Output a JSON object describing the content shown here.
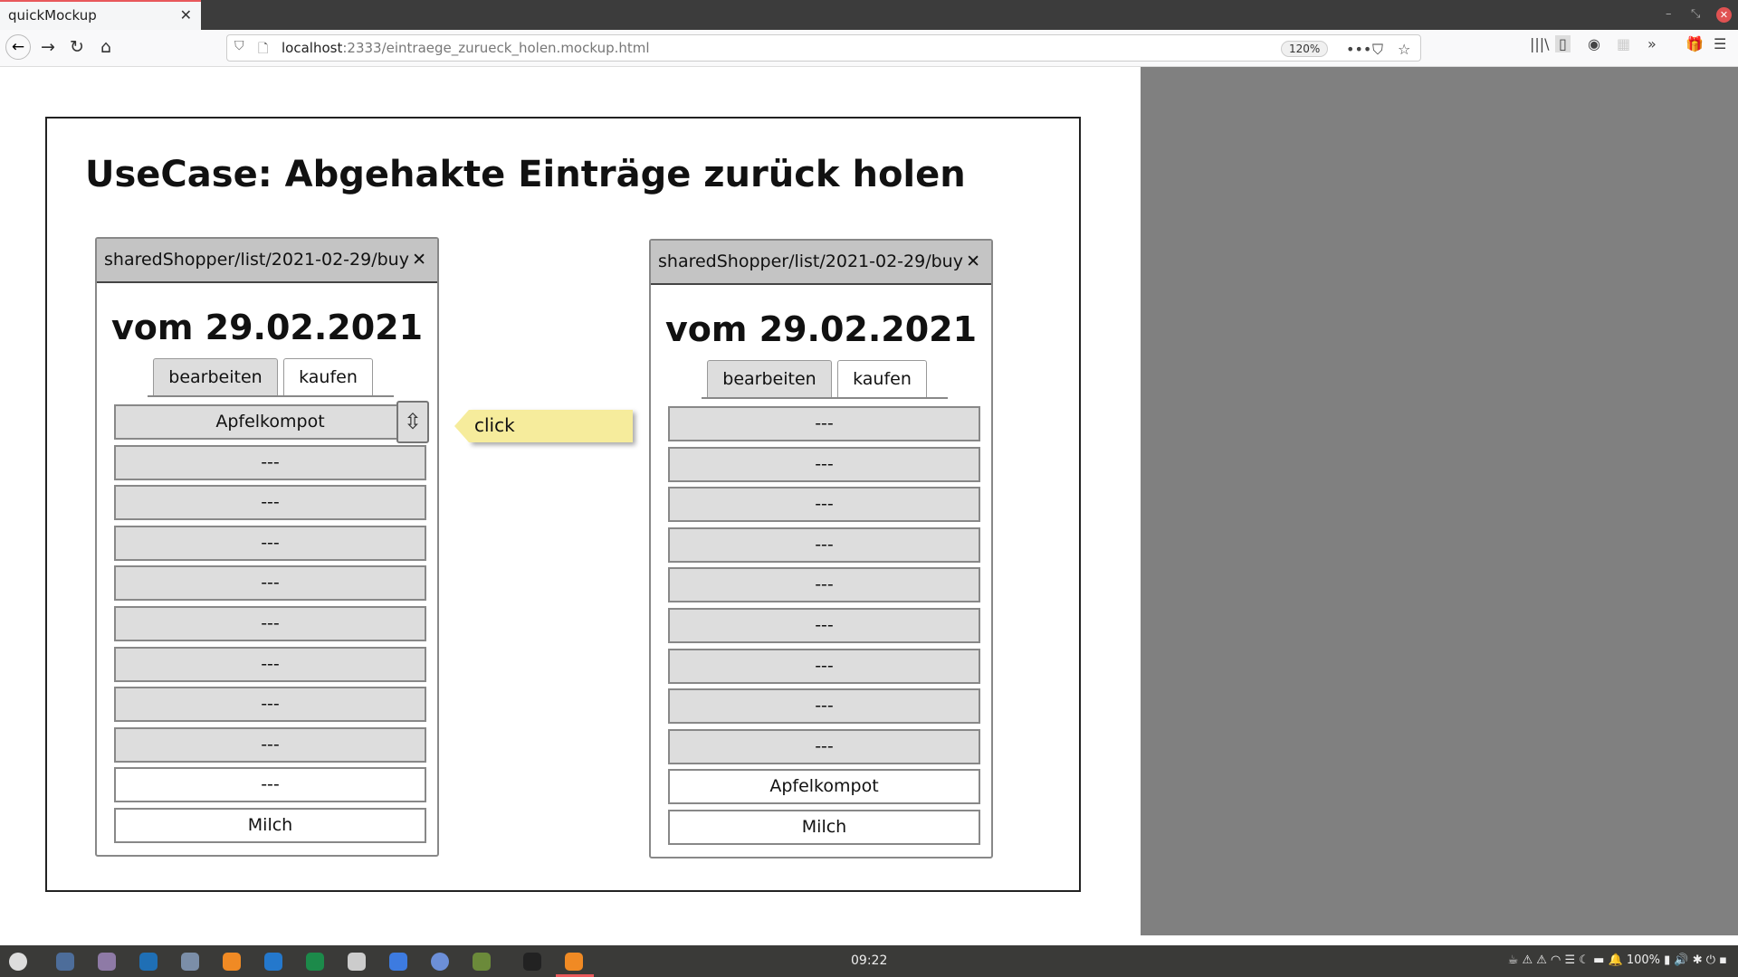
{
  "browser": {
    "tab_title": "quickMockup",
    "url_host": "localhost",
    "url_path": ":2333/eintraege_zurueck_holen.mockup.html",
    "zoom": "120%"
  },
  "mockup": {
    "title": "UseCase: Abgehakte Einträge zurück holen",
    "left": {
      "header": "sharedShopper/list/2021-02-29/buy",
      "date": "vom 29.02.2021",
      "tabs": [
        "bearbeiten",
        "kaufen"
      ],
      "rows": [
        {
          "text": "Apfelkompot",
          "checked": false
        },
        {
          "text": "---",
          "checked": false
        },
        {
          "text": "---",
          "checked": false
        },
        {
          "text": "---",
          "checked": false
        },
        {
          "text": "---",
          "checked": false
        },
        {
          "text": "---",
          "checked": false
        },
        {
          "text": "---",
          "checked": false
        },
        {
          "text": "---",
          "checked": false
        },
        {
          "text": "---",
          "checked": false
        },
        {
          "text": "---",
          "checked": true
        },
        {
          "text": "Milch",
          "checked": true
        }
      ]
    },
    "right": {
      "header": "sharedShopper/list/2021-02-29/buy",
      "date": "vom 29.02.2021",
      "tabs": [
        "bearbeiten",
        "kaufen"
      ],
      "rows": [
        {
          "text": "---",
          "checked": false
        },
        {
          "text": "---",
          "checked": false
        },
        {
          "text": "---",
          "checked": false
        },
        {
          "text": "---",
          "checked": false
        },
        {
          "text": "---",
          "checked": false
        },
        {
          "text": "---",
          "checked": false
        },
        {
          "text": "---",
          "checked": false
        },
        {
          "text": "---",
          "checked": false
        },
        {
          "text": "---",
          "checked": false
        },
        {
          "text": "Apfelkompot",
          "checked": true
        },
        {
          "text": "Milch",
          "checked": true
        }
      ]
    },
    "callout": "click"
  },
  "taskbar": {
    "clock": "09:22",
    "battery": "100%"
  }
}
